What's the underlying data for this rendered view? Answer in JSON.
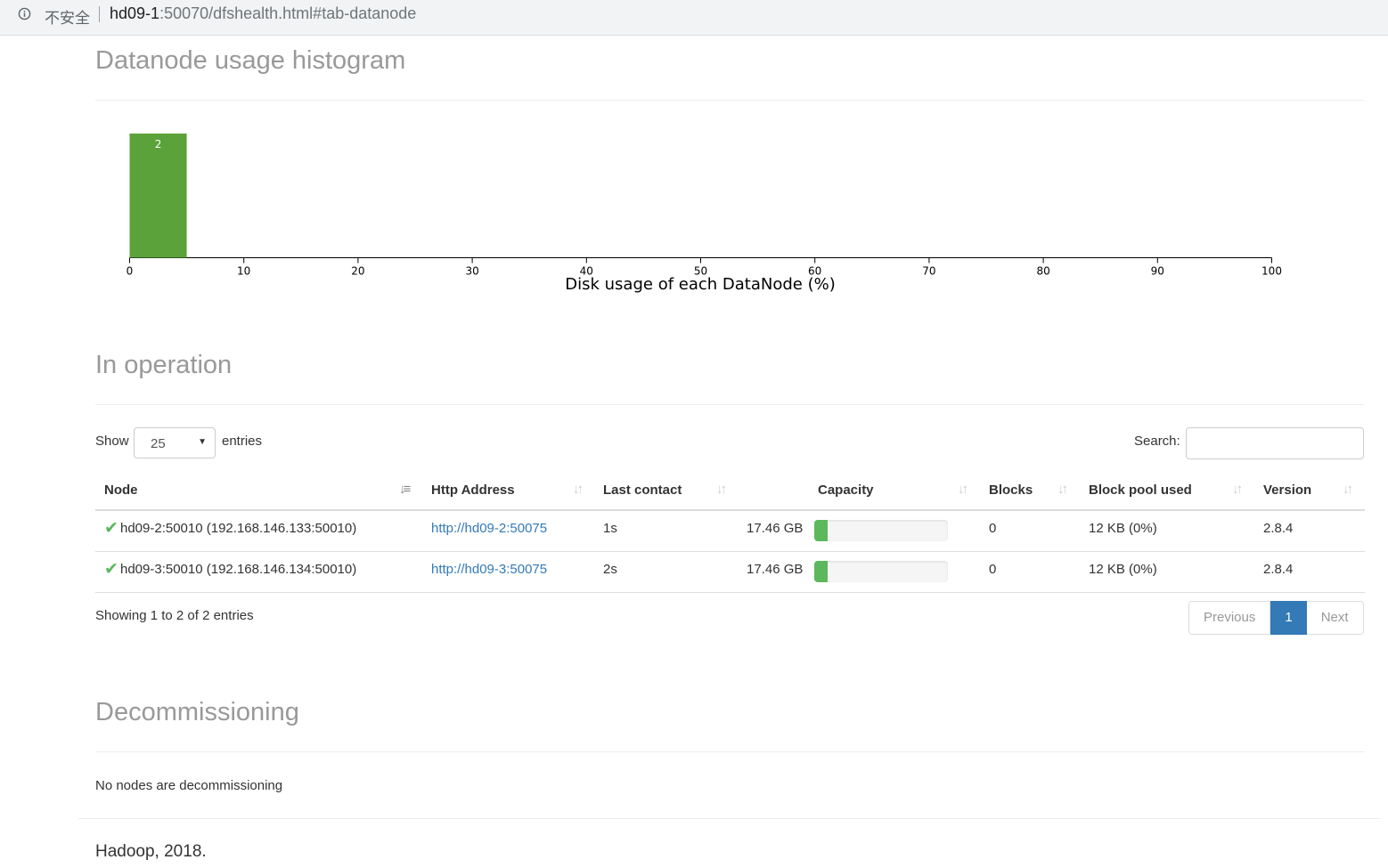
{
  "browser": {
    "security_label": "不安全",
    "url_host": "hd09-1",
    "url_rest": ":50070/dfshealth.html#tab-datanode"
  },
  "sections": {
    "histogram_title": "Datanode usage histogram",
    "in_operation_title": "In operation",
    "decommissioning_title": "Decommissioning"
  },
  "chart_data": {
    "type": "bar",
    "title": "",
    "xlabel": "Disk usage of each DataNode (%)",
    "ylabel": "",
    "xlim": [
      0,
      100
    ],
    "x_ticks": [
      0,
      10,
      20,
      30,
      40,
      50,
      60,
      70,
      80,
      90,
      100
    ],
    "bins": [
      {
        "from": 0,
        "to": 5,
        "count": 2
      }
    ],
    "bar_color": "#5ba23a"
  },
  "table_controls": {
    "show_label": "Show",
    "page_length": "25",
    "entries_label": "entries",
    "search_label": "Search:",
    "search_value": ""
  },
  "columns": [
    "Node",
    "Http Address",
    "Last contact",
    "Capacity",
    "Blocks",
    "Block pool used",
    "Version"
  ],
  "rows": [
    {
      "node": "hd09-2:50010 (192.168.146.133:50010)",
      "http": "http://hd09-2:50075",
      "last_contact": "1s",
      "capacity": "17.46 GB",
      "usage_fraction": 0.1,
      "blocks": "0",
      "block_pool_used": "12 KB (0%)",
      "version": "2.8.4"
    },
    {
      "node": "hd09-3:50010 (192.168.146.134:50010)",
      "http": "http://hd09-3:50075",
      "last_contact": "2s",
      "capacity": "17.46 GB",
      "usage_fraction": 0.1,
      "blocks": "0",
      "block_pool_used": "12 KB (0%)",
      "version": "2.8.4"
    }
  ],
  "table_info": "Showing 1 to 2 of 2 entries",
  "pagination": {
    "previous": "Previous",
    "current": "1",
    "next": "Next"
  },
  "decommissioning_text": "No nodes are decommissioning",
  "footer": "Hadoop, 2018.",
  "colors": {
    "accent": "#337ab7",
    "success": "#5cb85c"
  }
}
